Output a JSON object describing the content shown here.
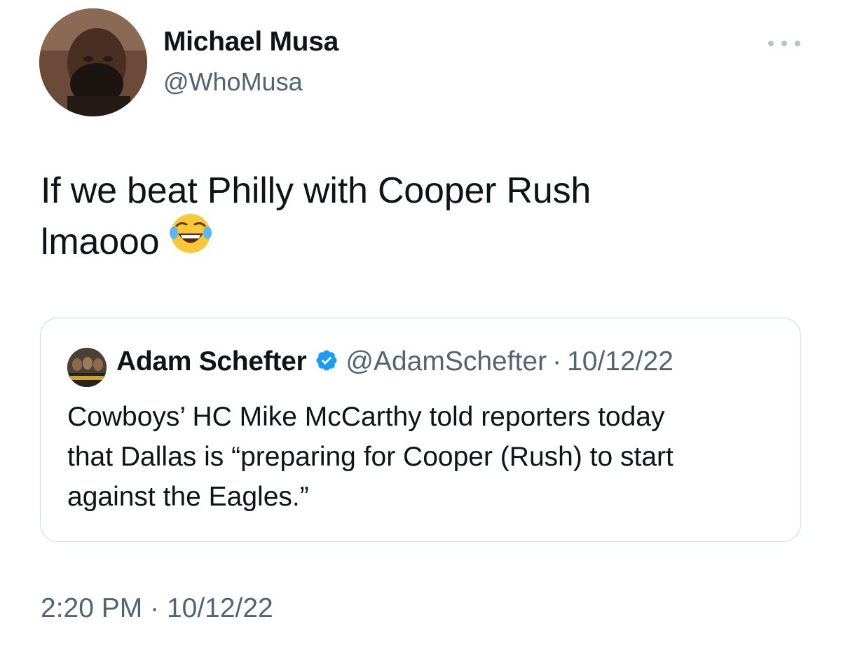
{
  "tweet": {
    "author_name": "Michael Musa",
    "author_handle": "@WhoMusa",
    "text_line1": "If we beat Philly with Cooper Rush",
    "text_line2": "lmaooo",
    "emoji": "face-with-tears-of-joy",
    "time": "2:20 PM",
    "separator": "·",
    "date": "10/12/22"
  },
  "quoted": {
    "author_name": "Adam Schefter",
    "author_handle": "@AdamSchefter",
    "separator": "·",
    "date": "10/12/22",
    "body_line1": "Cowboys’ HC Mike McCarthy told reporters today",
    "body_line2": "that Dallas is “preparing for Cooper (Rush) to start",
    "body_line3": "against the Eagles.”"
  },
  "colors": {
    "text_primary": "#0f1419",
    "text_secondary": "#536471",
    "border": "#cfd9de",
    "verified_blue": "#1d9bf0"
  },
  "icons": {
    "more": "more-horizontal-icon",
    "verified": "verified-badge-icon"
  }
}
